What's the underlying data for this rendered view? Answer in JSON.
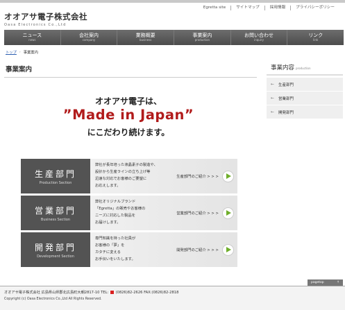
{
  "header": {
    "company_name": "オオアサ電子株式会社",
    "company_name_en": "Oasa Electronics Co.,Ltd",
    "top_links": [
      "Egretta site",
      "サイトマップ",
      "採用情報",
      "プライバシーポリシー"
    ]
  },
  "nav": [
    {
      "label": "ニュース",
      "sub": "news"
    },
    {
      "label": "会社案内",
      "sub": "company"
    },
    {
      "label": "業務概要",
      "sub": "business"
    },
    {
      "label": "事業案内",
      "sub": "production"
    },
    {
      "label": "お問い合わせ",
      "sub": "inquiry"
    },
    {
      "label": "リンク",
      "sub": "link"
    }
  ],
  "breadcrumb": {
    "home": "トップ",
    "separator": "›",
    "current": "事業案内"
  },
  "page_title": "事業案内",
  "hero": {
    "line1": "オオアサ電子は、",
    "line2": "”Made in Japan”",
    "line3": "にこだわり続けます。"
  },
  "departments": [
    {
      "title": "生産部門",
      "title_en": "Production Section",
      "desc": [
        "弊社が長年培った液晶素子の製造や、",
        "設計から生産ラインの立ち上げ等",
        "迅速な対応でお客様のご要望に",
        "お応えします。"
      ],
      "more": "生産部門のご紹介 > > >"
    },
    {
      "title": "営業部門",
      "title_en": "Business Section",
      "desc": [
        "弊社オリジナルブランド",
        "「Egretta」の販売やお客様の",
        "ニーズに対応した製品を",
        "お届けします。"
      ],
      "more": "営業部門のご紹介 > > >"
    },
    {
      "title": "開発部門",
      "title_en": "Development Section",
      "desc": [
        "専門知識を持った社員が",
        "お客様の「夢」を",
        "カタチに変える",
        "お手伝いをいたします。"
      ],
      "more": "開発部門のご紹介 > > >"
    }
  ],
  "sidebar": {
    "title": "事業内容",
    "title_en": "production",
    "items": [
      "生産部門",
      "営業部門",
      "開発部門"
    ]
  },
  "pagetop": {
    "label": "pagetop",
    "icon": "↑"
  },
  "footer": {
    "address": "オオアサ電子株式会社 広島県山県郡北広島町大朝2817-10 TEL:",
    "tel": "(0826)82-2626",
    "fax": "FAX:(0826)82-2818",
    "copyright": "Copyright (c) Oasa Electronics Co.,Ltd All Rights Reserved."
  },
  "colors": {
    "accent_red": "#b11b1b",
    "nav_bg": "#555555",
    "go_arrow": "#6fae2b"
  }
}
